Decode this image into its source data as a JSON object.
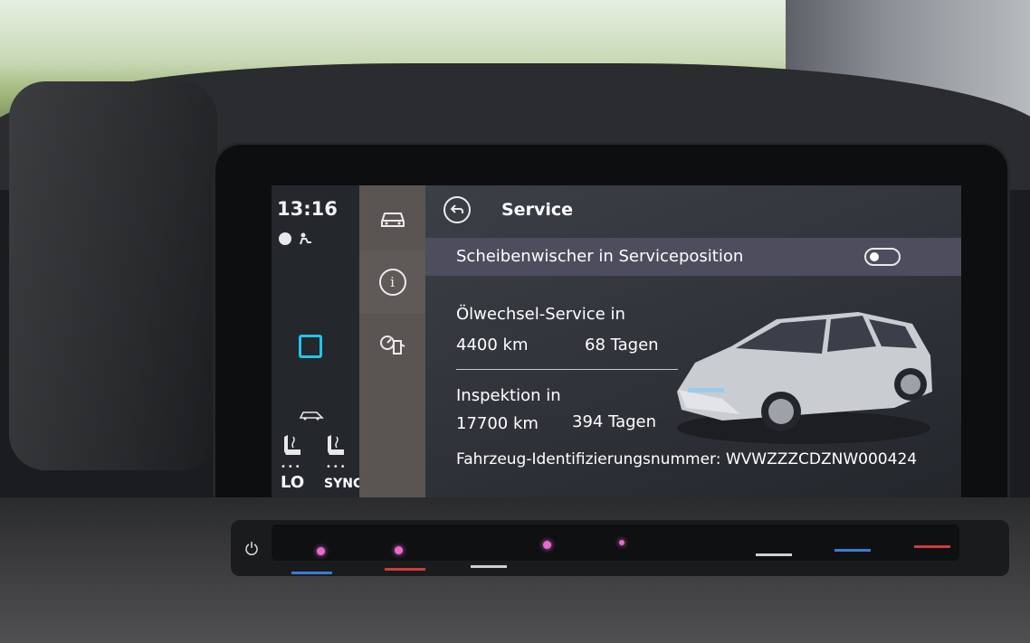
{
  "status": {
    "time": "13:16",
    "lo_label": "LO",
    "sync_label": "SYNC",
    "dots": "•••"
  },
  "menu": {
    "items": [
      {
        "icon": "car-icon",
        "active": false
      },
      {
        "icon": "info-icon",
        "active": true,
        "glyph": "i"
      },
      {
        "icon": "fuel-service-icon",
        "active": false
      }
    ]
  },
  "header": {
    "title": "Service"
  },
  "wiper": {
    "label": "Scheibenwischer in Serviceposition",
    "toggle_on": false
  },
  "oil_service": {
    "title": "Ölwechsel-Service in",
    "distance": "4400 km",
    "days": "68 Tagen"
  },
  "inspection": {
    "title": "Inspektion in",
    "distance": "17700 km",
    "days": "394 Tagen"
  },
  "vin_text": "Fahrzeug-Identifizierungsnummer: WVWZZZCDZNW000424",
  "colors": {
    "accent": "#21c5e8",
    "led": "#e56bd0",
    "stripe_blue": "#3a7bd5",
    "stripe_red": "#d33a3a"
  }
}
